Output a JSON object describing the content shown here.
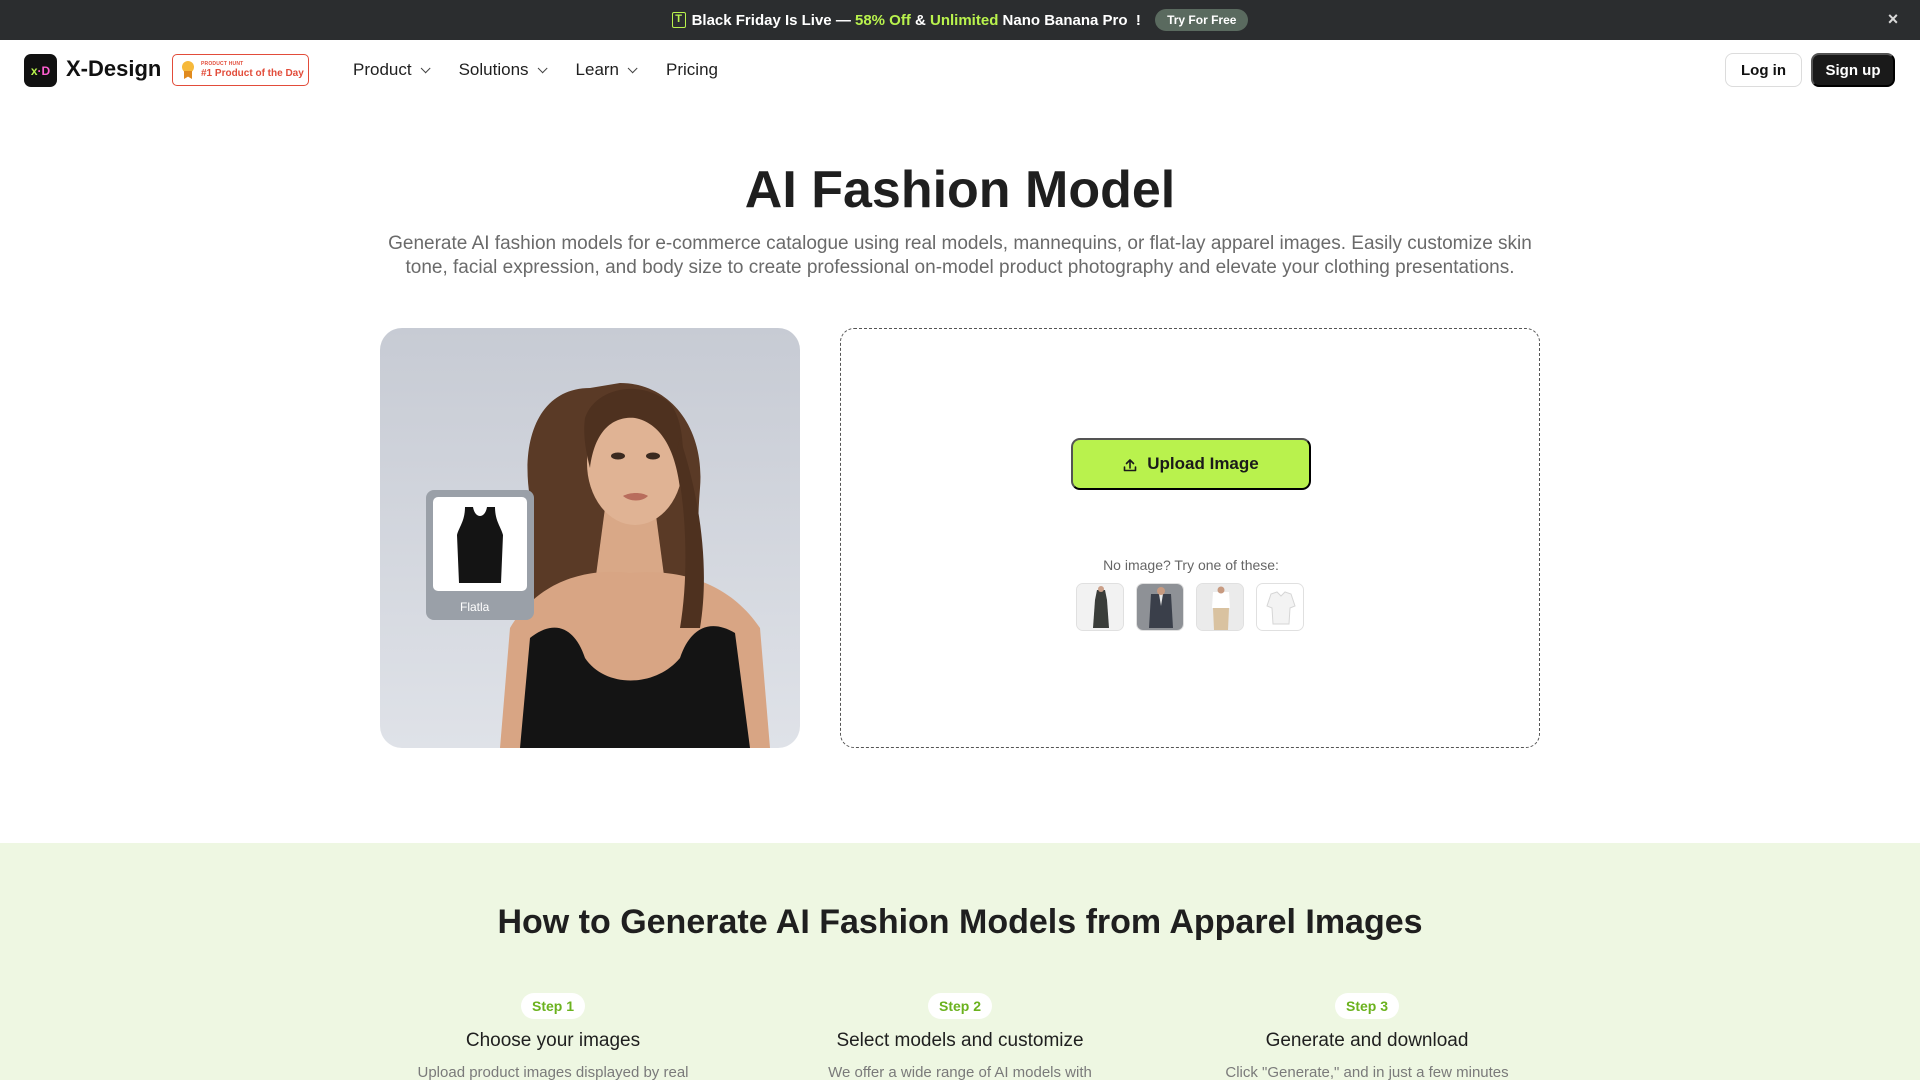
{
  "promo": {
    "text_1": "Black Friday Is Live — ",
    "text_green_1": "58% Off",
    "text_2": " & ",
    "text_green_2": "Unlimited",
    "text_3": " Nano Banana Pro  ! ",
    "try_button": "Try For Free",
    "close_icon": "×"
  },
  "nav": {
    "brand": "X-Design",
    "badge_small": "PRODUCT HUNT",
    "badge_big": "#1 Product of the Day",
    "menu": [
      {
        "label": "Product",
        "has_dropdown": true
      },
      {
        "label": "Solutions",
        "has_dropdown": true
      },
      {
        "label": "Learn",
        "has_dropdown": true
      },
      {
        "label": "Pricing",
        "has_dropdown": false
      }
    ],
    "login": "Log in",
    "signup": "Sign up"
  },
  "hero": {
    "title": "AI Fashion Model",
    "description": "Generate AI fashion models for e-commerce catalogue using real models, mannequins, or flat-lay apparel images. Easily customize skin tone, facial expression, and body size to create professional on-model product photography and elevate your clothing presentations.",
    "preview_flatlay_label": "Flatla"
  },
  "upload": {
    "button_label": "Upload Image",
    "try_text": "No image? Try one of these:",
    "samples": [
      "dark-dress-sample",
      "suit-sample",
      "white-top-beige-pants-sample",
      "white-shirt-sample"
    ]
  },
  "howto": {
    "title": "How to Generate AI Fashion Models from Apparel Images",
    "steps": [
      {
        "pill": "Step 1",
        "title": "Choose your images",
        "desc": "Upload product images displayed by real"
      },
      {
        "pill": "Step 2",
        "title": "Select models and customize",
        "desc": "We offer a wide range of AI models with"
      },
      {
        "pill": "Step 3",
        "title": "Generate and download",
        "desc": "Click \"Generate,\" and in just a few minutes"
      }
    ]
  },
  "colors": {
    "accent": "#b9f24d",
    "promo_bg": "#2b2d2f",
    "badge_red": "#e24c3a",
    "howto_bg": "#eef7e2",
    "step_green": "#6bb21e"
  }
}
